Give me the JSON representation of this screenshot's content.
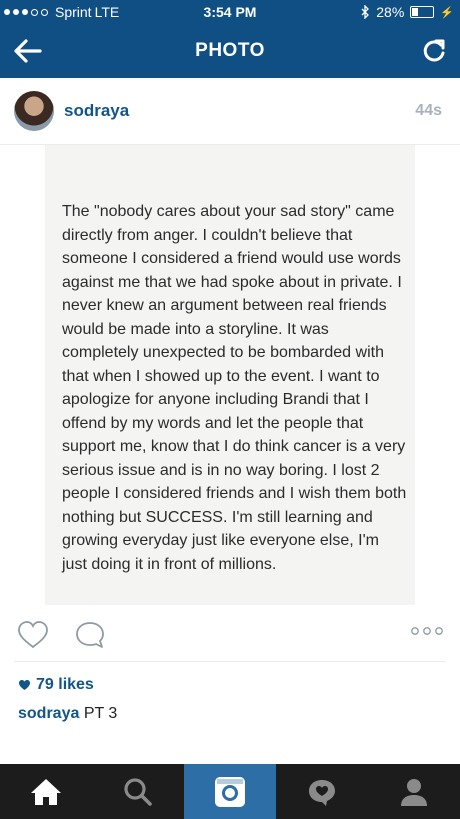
{
  "status_bar": {
    "carrier": "Sprint",
    "network": "LTE",
    "time": "3:54 PM",
    "battery_percent": "28%",
    "battery_level": 0.28
  },
  "nav": {
    "title": "PHOTO",
    "back_icon": "arrow-left-icon",
    "refresh_icon": "refresh-icon"
  },
  "post": {
    "username": "sodraya",
    "time_ago": "44s",
    "note_text": "The \"nobody cares about your sad story\" came directly from anger.  I couldn't believe that someone I considered a friend would use words against me that we had spoke about in private. I never knew an argument between real friends would be made into a storyline. It was completely unexpected to be bombarded with that when I showed up to the event. I want to apologize for anyone including Brandi that I offend by my words and let the people that support me, know that I do think cancer is a very serious issue and is in no way boring. I lost 2 people I considered friends and I wish them both nothing but SUCCESS. I'm still learning and growing everyday just like everyone else, I'm just doing it in front of millions.",
    "likes": "79 likes",
    "caption_user": "sodraya",
    "caption_text": "PT 3"
  },
  "tabs": [
    "home-icon",
    "search-icon",
    "camera-icon",
    "news-icon",
    "profile-icon"
  ],
  "colors": {
    "brand_blue": "#0f4f84",
    "link_blue": "#125688",
    "tabbar": "#1c1c1c",
    "active_tab": "#2d6ea6"
  }
}
